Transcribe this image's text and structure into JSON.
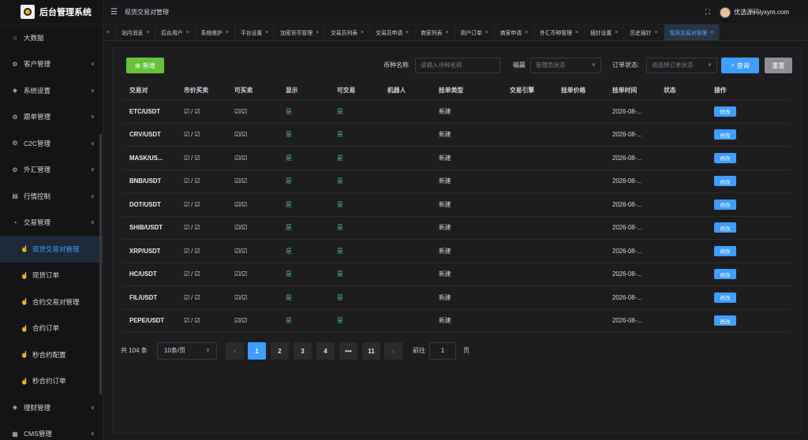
{
  "app": {
    "title": "后台管理系统"
  },
  "header": {
    "breadcrumb": "现货交易对管理",
    "user": "优选源码lyxym.com"
  },
  "sidebar": {
    "items": [
      {
        "label": "大数据",
        "icon": "home-icon",
        "glyph": "⌂"
      },
      {
        "label": "客户管理",
        "icon": "gear-icon",
        "glyph": "⚙",
        "chevron": "∨"
      },
      {
        "label": "系统设置",
        "icon": "shield-icon",
        "glyph": "◈",
        "chevron": "∨"
      },
      {
        "label": "跟单管理",
        "icon": "gear-icon",
        "glyph": "⚙",
        "chevron": "∨"
      },
      {
        "label": "C2C管理",
        "icon": "gear-icon",
        "glyph": "⚙",
        "chevron": "∨"
      },
      {
        "label": "外汇管理",
        "icon": "gear-icon",
        "glyph": "⚙",
        "chevron": "∨"
      },
      {
        "label": "行情控制",
        "icon": "chart-icon",
        "glyph": "▤",
        "chevron": "∨"
      },
      {
        "label": "交易管理",
        "icon": "alarm-icon",
        "glyph": "◔",
        "chevron": "∧"
      }
    ],
    "sub_items": [
      {
        "label": "现货交易对管理",
        "icon": "thumb-icon",
        "glyph": "☝",
        "active": true
      },
      {
        "label": "现货订单",
        "icon": "thumb-icon",
        "glyph": "☝"
      },
      {
        "label": "合约交易对管理",
        "icon": "thumb-icon",
        "glyph": "☝"
      },
      {
        "label": "合约订单",
        "icon": "thumb-icon",
        "glyph": "☝"
      },
      {
        "label": "秒合约配置",
        "icon": "thumb-icon",
        "glyph": "☝"
      },
      {
        "label": "秒合约订单",
        "icon": "thumb-icon",
        "glyph": "☝"
      }
    ],
    "bottom_items": [
      {
        "label": "理财管理",
        "icon": "shield-icon",
        "glyph": "◈",
        "chevron": "∨"
      },
      {
        "label": "CMS管理",
        "icon": "grid-icon",
        "glyph": "▦",
        "chevron": "∨"
      }
    ]
  },
  "tabs": [
    {
      "label": "",
      "close": "×"
    },
    {
      "label": "站内消息",
      "close": "×"
    },
    {
      "label": "后台用户",
      "close": "×"
    },
    {
      "label": "系统维护",
      "close": "×"
    },
    {
      "label": "平台设置",
      "close": "×"
    },
    {
      "label": "加密货币管理",
      "close": "×"
    },
    {
      "label": "交易员列表",
      "close": "×"
    },
    {
      "label": "交易员申请",
      "close": "×"
    },
    {
      "label": "商家列表",
      "close": "×"
    },
    {
      "label": "用户订单",
      "close": "×"
    },
    {
      "label": "商家申请",
      "close": "×"
    },
    {
      "label": "外汇币种管理",
      "close": "×"
    },
    {
      "label": "插针设置",
      "close": "×"
    },
    {
      "label": "历史插针",
      "close": "×"
    },
    {
      "label": "现货交易对管理",
      "close": "×",
      "active": true
    }
  ],
  "toolbar": {
    "add_label": "新增",
    "coin_label": "币种名称",
    "coin_placeholder": "请输入币种名称",
    "winlose_label": "输赢",
    "winlose_placeholder": "管理员状态",
    "order_label": "订单状态:",
    "order_placeholder": "请选择订单状态",
    "search_label": "查询",
    "reset_label": "重置"
  },
  "table": {
    "columns": [
      "交易对",
      "市价买卖",
      "可买卖",
      "显示",
      "可交易",
      "机器人",
      "挂单类型",
      "交易引擎",
      "挂单价格",
      "挂单时间",
      "状态",
      "操作"
    ],
    "rows": [
      {
        "pair": "ETC/USDT",
        "market": "☑ / ☑",
        "tradable": "☑/☑",
        "show": "是",
        "can_trade": "是",
        "robot": "",
        "order_type": "新建",
        "engine": "",
        "price": "",
        "time": "2026-08-...",
        "status": "",
        "action": "修改"
      },
      {
        "pair": "CRV/USDT",
        "market": "☑ / ☑",
        "tradable": "☑/☑",
        "show": "是",
        "can_trade": "是",
        "robot": "",
        "order_type": "新建",
        "engine": "",
        "price": "",
        "time": "2026-08-...",
        "status": "",
        "action": "修改"
      },
      {
        "pair": "MASK/US...",
        "market": "☑ / ☑",
        "tradable": "☑/☑",
        "show": "是",
        "can_trade": "是",
        "robot": "",
        "order_type": "新建",
        "engine": "",
        "price": "",
        "time": "2026-08-...",
        "status": "",
        "action": "修改"
      },
      {
        "pair": "BNB/USDT",
        "market": "☑ / ☑",
        "tradable": "☑/☑",
        "show": "是",
        "can_trade": "是",
        "robot": "",
        "order_type": "新建",
        "engine": "",
        "price": "",
        "time": "2026-08-...",
        "status": "",
        "action": "修改"
      },
      {
        "pair": "DOT/USDT",
        "market": "☑ / ☑",
        "tradable": "☑/☑",
        "show": "是",
        "can_trade": "是",
        "robot": "",
        "order_type": "新建",
        "engine": "",
        "price": "",
        "time": "2026-08-...",
        "status": "",
        "action": "修改"
      },
      {
        "pair": "SHIB/USDT",
        "market": "☑ / ☑",
        "tradable": "☑/☑",
        "show": "是",
        "can_trade": "是",
        "robot": "",
        "order_type": "新建",
        "engine": "",
        "price": "",
        "time": "2026-08-...",
        "status": "",
        "action": "修改"
      },
      {
        "pair": "XRP/USDT",
        "market": "☑ / ☑",
        "tradable": "☑/☑",
        "show": "是",
        "can_trade": "是",
        "robot": "",
        "order_type": "新建",
        "engine": "",
        "price": "",
        "time": "2026-08-...",
        "status": "",
        "action": "修改"
      },
      {
        "pair": "HC/USDT",
        "market": "☑ / ☑",
        "tradable": "☑/☑",
        "show": "是",
        "can_trade": "是",
        "robot": "",
        "order_type": "新建",
        "engine": "",
        "price": "",
        "time": "2026-08-...",
        "status": "",
        "action": "修改"
      },
      {
        "pair": "FIL/USDT",
        "market": "☑ / ☑",
        "tradable": "☑/☑",
        "show": "是",
        "can_trade": "是",
        "robot": "",
        "order_type": "新建",
        "engine": "",
        "price": "",
        "time": "2026-08-...",
        "status": "",
        "action": "修改"
      },
      {
        "pair": "PEPE/USDT",
        "market": "☑ / ☑",
        "tradable": "☑/☑",
        "show": "是",
        "can_trade": "是",
        "robot": "",
        "order_type": "新建",
        "engine": "",
        "price": "",
        "time": "2026-08-...",
        "status": "",
        "action": "修改"
      }
    ]
  },
  "pagination": {
    "total": "共 104 条",
    "page_size": "10条/页",
    "prev": "‹",
    "next": "›",
    "pages": [
      "1",
      "2",
      "3",
      "4",
      "•••",
      "11"
    ],
    "current": "1",
    "goto_label": "前往",
    "goto_value": "1",
    "page_suffix": "页"
  },
  "colors": {
    "accent": "#409eff",
    "success": "#67c23a",
    "yes_text": "#4fc08d"
  }
}
